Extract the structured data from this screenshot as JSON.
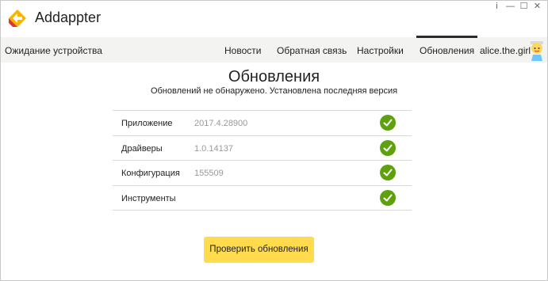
{
  "app": {
    "title": "Addappter",
    "logo_icon": "addappter-logo"
  },
  "window_controls": [
    "i",
    "—",
    "☐",
    "✕"
  ],
  "nav": {
    "device_status": "Ожидание устройства",
    "tabs": [
      "Новости",
      "Обратная связь",
      "Настройки",
      "Обновления"
    ],
    "active_tab": "Обновления",
    "user_name": "alice.the.girl",
    "avatar_icon": "user-avatar"
  },
  "page": {
    "title": "Обновления",
    "subtitle": "Обновлений не обнаружено. Установлена последняя версия"
  },
  "updates": [
    {
      "label": "Приложение",
      "version": "2017.4.28900",
      "status": "up-to-date"
    },
    {
      "label": "Драйверы",
      "version": "1.0.14137",
      "status": "up-to-date"
    },
    {
      "label": "Конфигурация",
      "version": "155509",
      "status": "up-to-date"
    },
    {
      "label": "Инструменты",
      "version": "",
      "status": "up-to-date"
    }
  ],
  "actions": {
    "check_updates_label": "Проверить обновления"
  },
  "colors": {
    "accent": "#ffdb4d",
    "check": "#5fa10a",
    "navbar": "#f3f3f2"
  }
}
